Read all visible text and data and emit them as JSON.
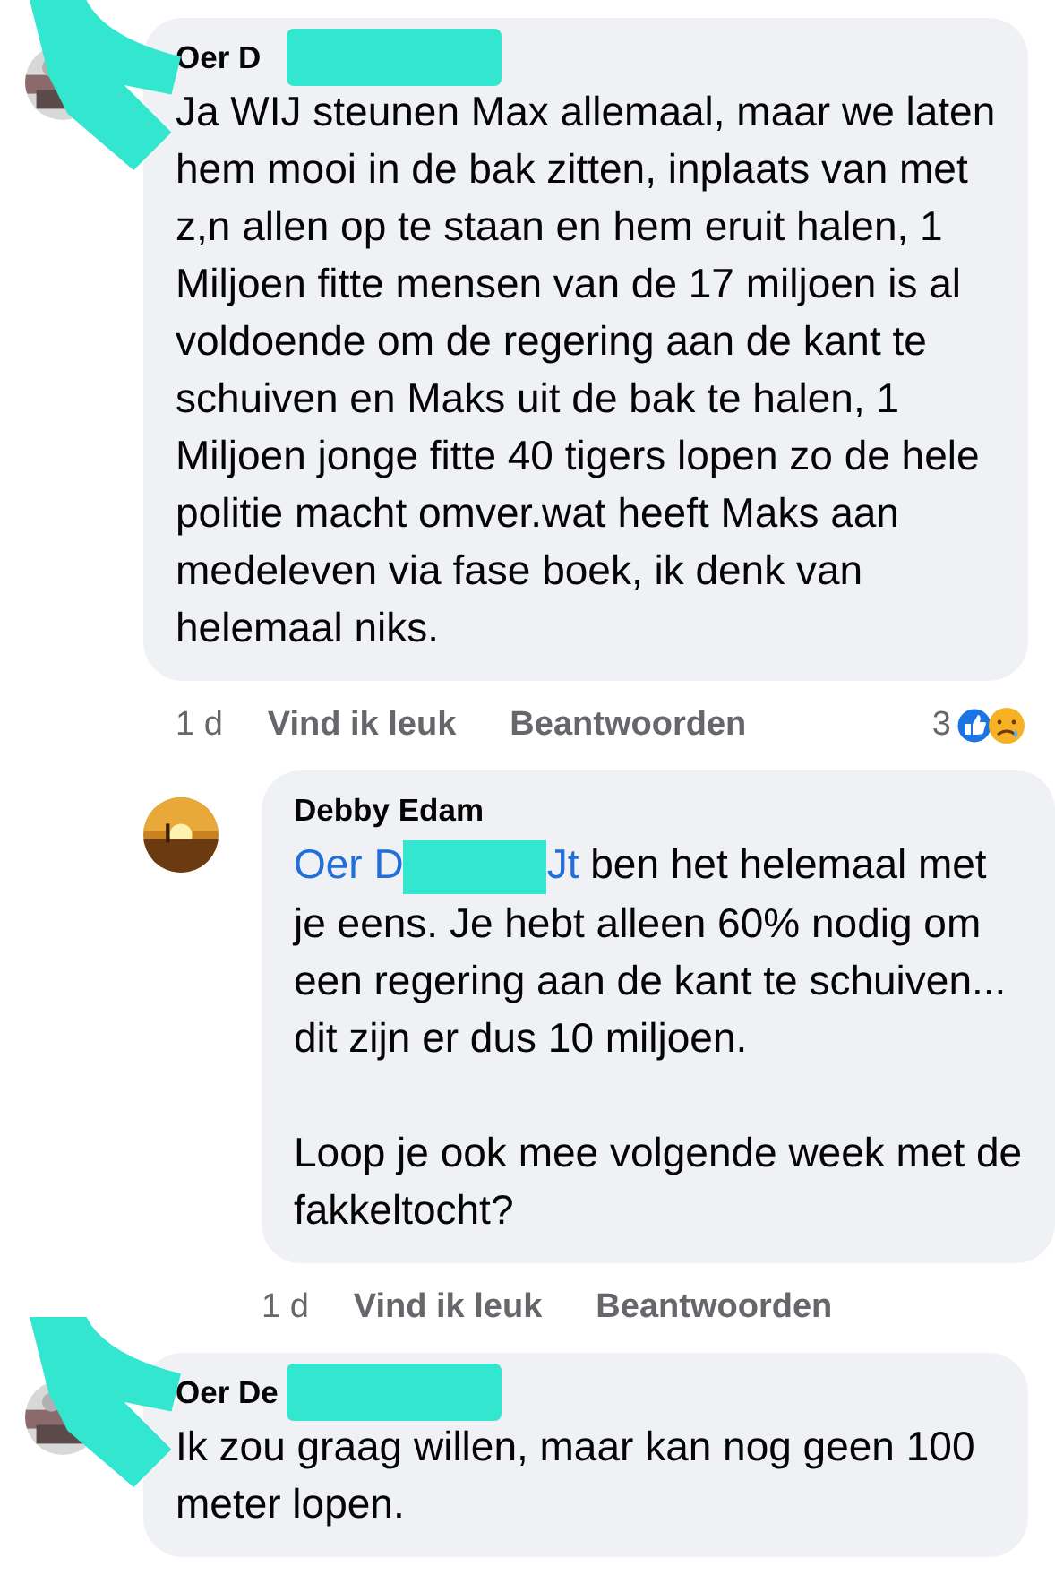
{
  "comments": [
    {
      "kind": "comment",
      "author": "Oer D",
      "redacted": true,
      "paragraphs": [
        {
          "text": "Ja WIJ steunen Max allemaal, maar we laten hem mooi in de bak zitten, inplaats van met z,n allen op te staan en hem eruit halen, 1 Miljoen fitte mensen van de 17 miljoen is al voldoende om de regering aan de kant te schuiven en Maks uit de bak te halen, 1 Miljoen jonge fitte 40 tigers lopen zo de hele politie macht omver.wat heeft Maks aan medeleven via fase boek, ik denk van helemaal niks."
        }
      ],
      "actions": {
        "time": "1 d",
        "like": "Vind ik leuk",
        "reply": "Beantwoorden"
      },
      "reactions": {
        "count": "3"
      }
    },
    {
      "kind": "reply",
      "author": "Debby Edam",
      "redacted": false,
      "paragraphs": [
        {
          "mention_start": "Oer D",
          "mention_end": "Jt",
          "text": "ben het helemaal met je eens. Je hebt alleen 60% nodig om een regering aan de kant te schuiven... dit zijn er dus 10 miljoen."
        },
        {
          "text": "Loop je ook mee volgende week met de fakkeltocht?"
        }
      ],
      "actions": {
        "time": "1 d",
        "like": "Vind ik leuk",
        "reply": "Beantwoorden"
      }
    },
    {
      "kind": "comment",
      "author": "Oer De",
      "redacted": true,
      "paragraphs": [
        {
          "text": "Ik zou graag willen, maar kan nog geen 100 meter lopen."
        }
      ]
    }
  ]
}
